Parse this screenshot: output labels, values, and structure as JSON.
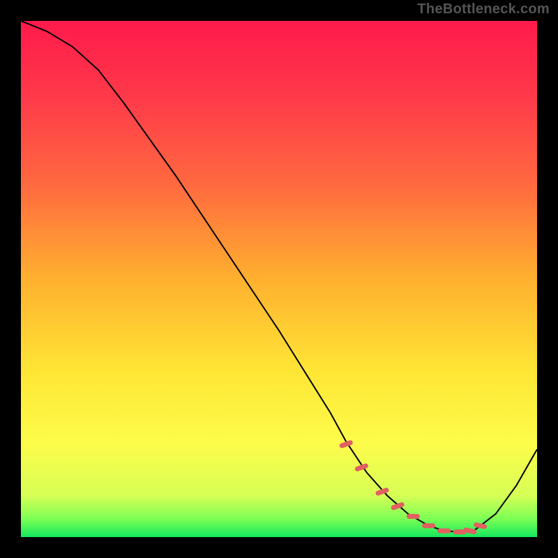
{
  "watermark": "TheBottleneck.com",
  "chart_data": {
    "type": "line",
    "title": "",
    "xlabel": "",
    "ylabel": "",
    "xlim": [
      0,
      100
    ],
    "ylim": [
      0,
      100
    ],
    "grid": false,
    "legend": false,
    "series": [
      {
        "name": "bottleneck-curve",
        "color": "#000000",
        "x": [
          0,
          5,
          10,
          15,
          20,
          25,
          30,
          35,
          40,
          45,
          50,
          55,
          60,
          63,
          67,
          71,
          75,
          79,
          82,
          85,
          88,
          92,
          96,
          100
        ],
        "y": [
          100,
          98,
          95,
          90.5,
          84,
          77,
          70,
          62.5,
          55,
          47.5,
          40,
          32,
          24,
          18.5,
          12.5,
          8,
          4.5,
          2.2,
          1.2,
          1.0,
          1.4,
          4.5,
          10,
          17
        ]
      }
    ],
    "highlight_band": {
      "name": "optimal-range-markers",
      "color": "#e16060",
      "points_x": [
        63,
        66,
        70,
        73,
        76,
        79,
        82,
        85,
        87,
        89
      ],
      "points_y": [
        18,
        13.5,
        8.8,
        6,
        4,
        2.2,
        1.2,
        1.0,
        1.2,
        2.2
      ]
    },
    "colors": {
      "gradient_stops": [
        {
          "offset": 0.0,
          "color": "#ff1a4b"
        },
        {
          "offset": 0.15,
          "color": "#ff3a4a"
        },
        {
          "offset": 0.32,
          "color": "#ff6a3f"
        },
        {
          "offset": 0.5,
          "color": "#ffb02f"
        },
        {
          "offset": 0.68,
          "color": "#ffe635"
        },
        {
          "offset": 0.82,
          "color": "#fdfc4a"
        },
        {
          "offset": 0.92,
          "color": "#d6ff55"
        },
        {
          "offset": 0.965,
          "color": "#7cff55"
        },
        {
          "offset": 1.0,
          "color": "#14e85e"
        }
      ],
      "marker": "#e16060",
      "curve": "#000000",
      "background": "#000000",
      "watermark": "#555555"
    }
  }
}
